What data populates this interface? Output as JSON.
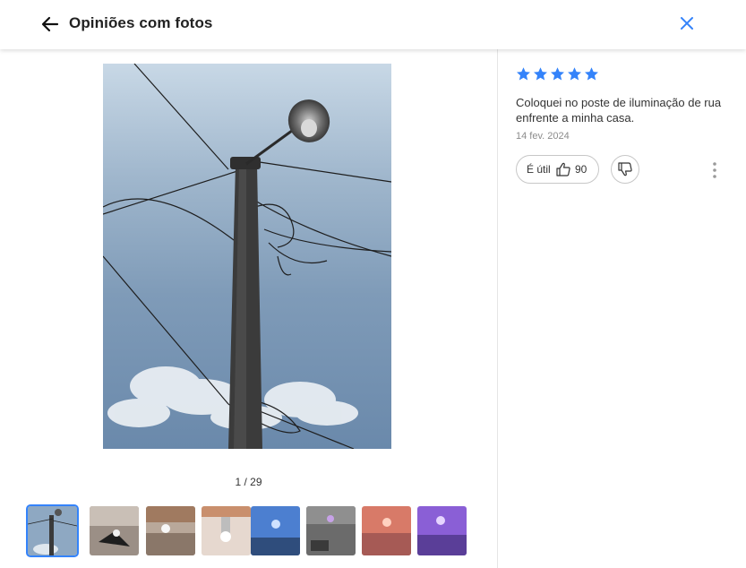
{
  "header": {
    "title": "Opiniões com fotos",
    "back_icon": "arrow-left-icon",
    "close_icon": "close-icon"
  },
  "gallery": {
    "counter": "1 / 29",
    "current_index": 1,
    "total": 29,
    "thumbnails": [
      {
        "name": "thumbnail-1",
        "active": true
      },
      {
        "name": "thumbnail-2",
        "active": false
      },
      {
        "name": "thumbnail-3",
        "active": false
      },
      {
        "name": "thumbnail-4",
        "active": false
      },
      {
        "name": "thumbnail-5",
        "active": false
      },
      {
        "name": "thumbnail-6",
        "active": false
      },
      {
        "name": "thumbnail-7",
        "active": false
      },
      {
        "name": "thumbnail-8",
        "active": false
      }
    ]
  },
  "review": {
    "rating": 5,
    "rating_max": 5,
    "text": "Coloquei no poste de iluminação de rua enfrente a minha casa.",
    "date": "14 fev. 2024",
    "useful_label": "É útil",
    "useful_count": "90"
  },
  "colors": {
    "accent": "#3483fa",
    "star": "#3483fa",
    "text": "#333333",
    "muted": "#8c8c8c",
    "border": "#c7c7c7"
  }
}
